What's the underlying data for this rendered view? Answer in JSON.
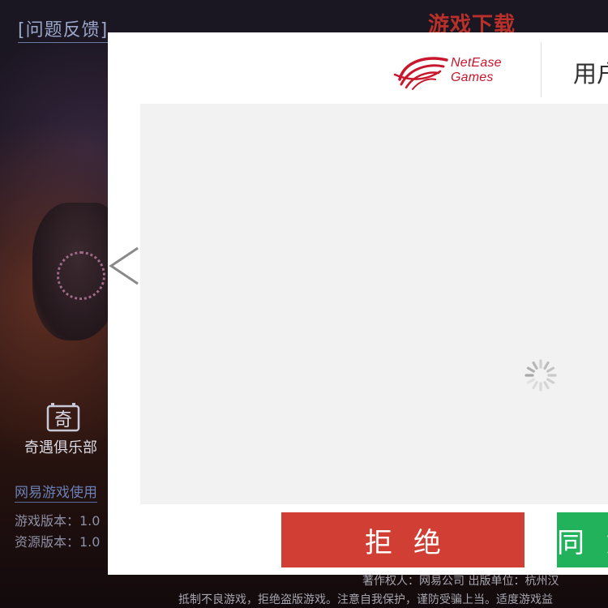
{
  "background": {
    "feedback_link": "[问题反馈]",
    "download_link": "游戏下载",
    "club_icon_char": "奇",
    "club_label": "奇遇俱乐部",
    "usage_link": "网易游戏使用",
    "game_version": "游戏版本：1.0",
    "resource_version": "资源版本：1.0",
    "footer_copyright": "著作权人：网易公司  出版单位：杭州汉",
    "footer_notice": "抵制不良游戏，拒绝盗版游戏。注意自我保护，谨防受骗上当。适度游戏益"
  },
  "dialog": {
    "logo_line1": "NetEase",
    "logo_line2": "Games",
    "title": "用户",
    "content_state": "loading",
    "refuse_button": "拒绝",
    "agree_button": "同意"
  },
  "colors": {
    "refuse": "#d13f34",
    "agree": "#23b25c",
    "brand_red": "#c8162c",
    "link_blue": "#9aa6c9"
  },
  "icons": {
    "prev": "chevron-left-icon",
    "loading": "spinner-icon",
    "logo": "netease-logo-icon",
    "club": "film-club-icon"
  }
}
